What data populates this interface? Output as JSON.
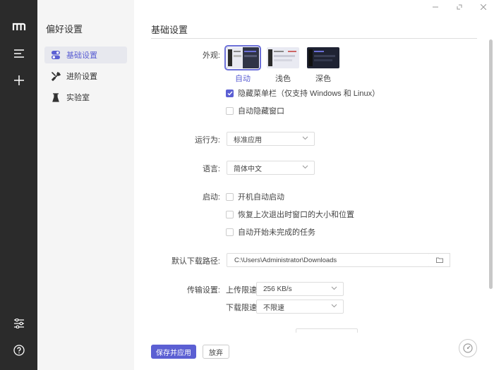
{
  "rail": {
    "items": [
      {
        "name": "logo",
        "icon": "m-logo-icon"
      },
      {
        "name": "tasks",
        "icon": "list-icon"
      },
      {
        "name": "add",
        "icon": "plus-icon"
      },
      {
        "name": "settings",
        "icon": "sliders-icon"
      },
      {
        "name": "help",
        "icon": "help-circle-icon"
      }
    ]
  },
  "nav": {
    "title": "偏好设置",
    "items": [
      {
        "label": "基础设置",
        "icon": "toggle-icon",
        "active": true
      },
      {
        "label": "进阶设置",
        "icon": "tools-icon",
        "active": false
      },
      {
        "label": "实验室",
        "icon": "flask-icon",
        "active": false
      }
    ]
  },
  "window_controls": [
    "minimize",
    "restore",
    "close"
  ],
  "page": {
    "title": "基础设置",
    "appearance": {
      "label": "外观:",
      "options": [
        {
          "label": "自动",
          "selected": true
        },
        {
          "label": "浅色",
          "selected": false
        },
        {
          "label": "深色",
          "selected": false
        }
      ],
      "checkboxes": [
        {
          "label": "隐藏菜单栏（仅支持 Windows 和 Linux）",
          "checked": true
        },
        {
          "label": "自动隐藏窗口",
          "checked": false
        }
      ]
    },
    "run_as": {
      "label": "运行为:",
      "value": "标准应用"
    },
    "language": {
      "label": "语言:",
      "value": "简体中文"
    },
    "startup": {
      "label": "启动:",
      "checkboxes": [
        {
          "label": "开机自动启动",
          "checked": false
        },
        {
          "label": "恢复上次退出时窗口的大小和位置",
          "checked": false
        },
        {
          "label": "自动开始未完成的任务",
          "checked": false
        }
      ]
    },
    "download_path": {
      "label": "默认下载路径:",
      "value": "C:\\Users\\Administrator\\Downloads"
    },
    "transfer": {
      "label": "传输设置:",
      "upload_label": "上传限速",
      "upload_value": "256 KB/s",
      "download_label": "下载限速",
      "download_value": "不限速"
    }
  },
  "footer": {
    "save_label": "保存并应用",
    "discard_label": "放弃"
  },
  "colors": {
    "accent": "#5b5fd3",
    "rail_bg": "#2b2b2b",
    "nav_bg": "#f5f5f5"
  }
}
